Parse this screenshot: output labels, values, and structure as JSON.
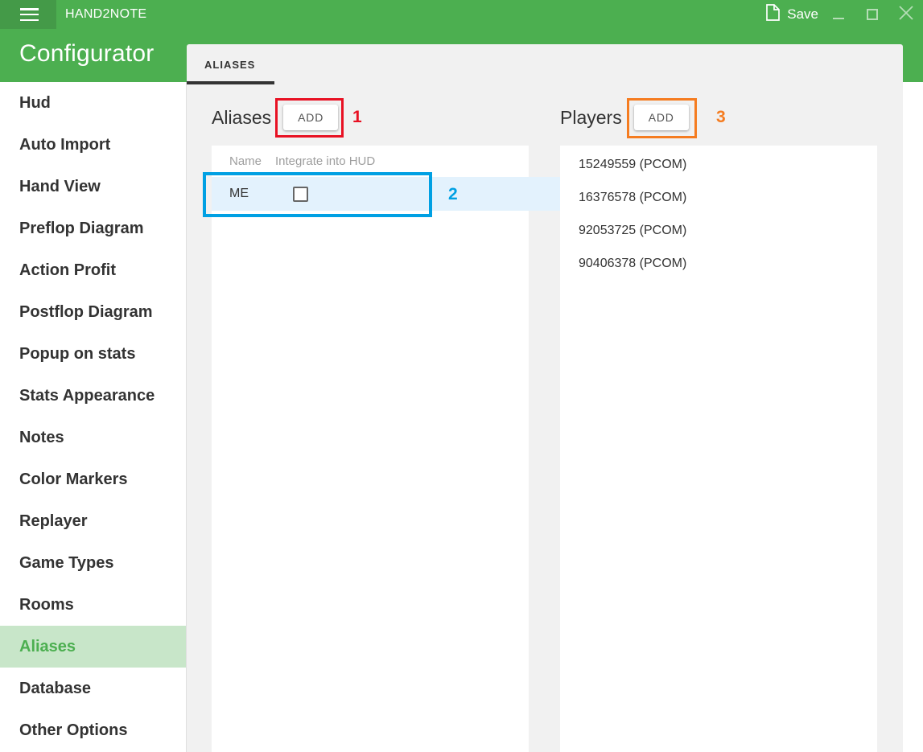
{
  "titlebar": {
    "app_title": "HAND2NOTE",
    "menu_icon": "hamburger-icon",
    "save_label": "Save",
    "save_icon": "document-icon",
    "minimize_label": "",
    "maximize_label": "",
    "close_label": "✕"
  },
  "header": {
    "title": "Configurator"
  },
  "sidebar": {
    "items": [
      {
        "label": "Hud",
        "selected": false
      },
      {
        "label": "Auto Import",
        "selected": false
      },
      {
        "label": "Hand View",
        "selected": false
      },
      {
        "label": "Preflop Diagram",
        "selected": false
      },
      {
        "label": "Action Profit",
        "selected": false
      },
      {
        "label": "Postflop Diagram",
        "selected": false
      },
      {
        "label": "Popup on stats",
        "selected": false
      },
      {
        "label": "Stats Appearance",
        "selected": false
      },
      {
        "label": "Notes",
        "selected": false
      },
      {
        "label": "Color Markers",
        "selected": false
      },
      {
        "label": "Replayer",
        "selected": false
      },
      {
        "label": "Game Types",
        "selected": false
      },
      {
        "label": "Rooms",
        "selected": false
      },
      {
        "label": "Aliases",
        "selected": true
      },
      {
        "label": "Database",
        "selected": false
      },
      {
        "label": "Other Options",
        "selected": false
      }
    ]
  },
  "tabs": [
    {
      "label": "ALIASES",
      "active": true
    }
  ],
  "aliases": {
    "title": "Aliases",
    "add_label": "ADD",
    "columns": [
      "Name",
      "Integrate into HUD"
    ],
    "rows": [
      {
        "name": "ME",
        "integrate_into_hud": false,
        "selected": true
      }
    ]
  },
  "players": {
    "title": "Players",
    "add_label": "ADD",
    "rows": [
      "15249559 (PCOM)",
      "16376578 (PCOM)",
      "92053725 (PCOM)",
      "90406378 (PCOM)"
    ]
  },
  "annotations": [
    {
      "number": "1",
      "color": "#e81123",
      "target": "aliases-add-button"
    },
    {
      "number": "2",
      "color": "#00a0e3",
      "target": "aliases-table-row-me"
    },
    {
      "number": "3",
      "color": "#f57c20",
      "target": "players-add-button"
    }
  ],
  "colors": {
    "brand_green": "#4caf50",
    "titlebar_green": "#449a48",
    "selected_sidebar_bg": "#c8e6c9",
    "selected_row_bg": "#e3f2fd",
    "panel_bg": "#f1f1f1"
  }
}
